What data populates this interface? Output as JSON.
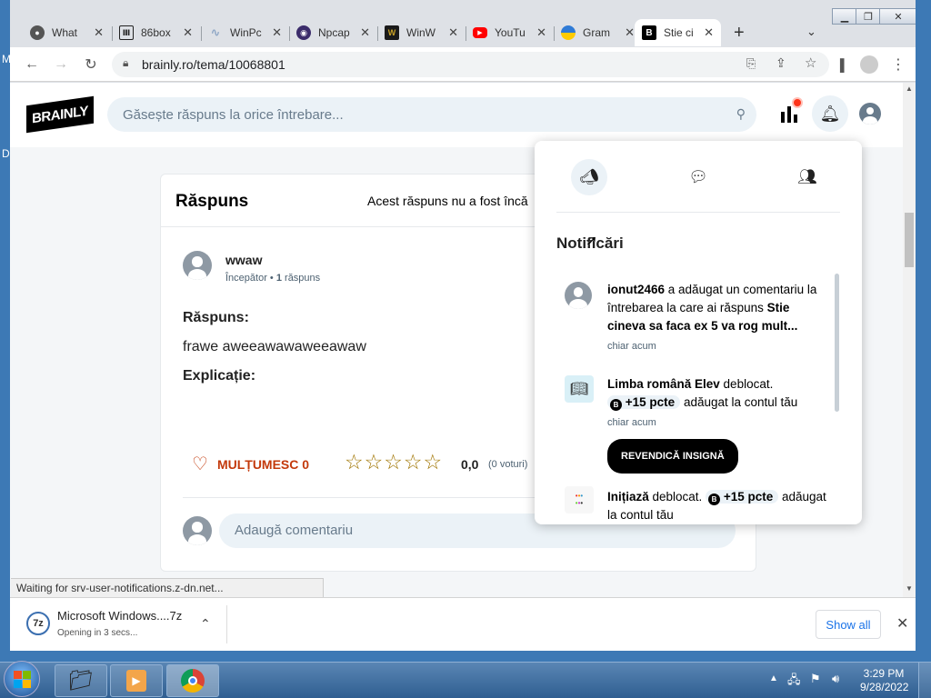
{
  "desktop": {
    "letter_top": "M",
    "letter_mid": "D"
  },
  "browser": {
    "tabs": [
      {
        "label": "What",
        "icon": "chrome-icon",
        "color": "#4285f4"
      },
      {
        "label": "86box",
        "icon": "library-icon",
        "color": "#222222"
      },
      {
        "label": "WinPc",
        "icon": "wave-icon",
        "color": "#8fa7c6"
      },
      {
        "label": "Npcap",
        "icon": "eye-icon",
        "color": "#3b2c6b"
      },
      {
        "label": "WinW",
        "icon": "w-logo-icon",
        "color": "#c9a227"
      },
      {
        "label": "YouTu",
        "icon": "youtube-icon",
        "color": "#ff0000"
      },
      {
        "label": "Gram",
        "icon": "globe-icon",
        "color": "#ffb300"
      },
      {
        "label": "Stie ci",
        "icon": "brainly-icon",
        "color": "#000000",
        "active": true
      }
    ],
    "url": "brainly.ro/tema/10068801",
    "status_text": "Waiting for srv-user-notifications.z-dn.net...",
    "download": {
      "filename": "Microsoft Windows....7z",
      "status": "Opening in 3 secs...",
      "show_all": "Show all"
    }
  },
  "brainly": {
    "logo": "BRAINLY",
    "search_placeholder": "Găsește răspuns la orice întrebare...",
    "answer": {
      "heading": "Răspuns",
      "note": "Acest răspuns nu a fost încă",
      "author": "wwaw",
      "rank": "Începător",
      "answers_count": "1",
      "answers_word": "răspuns",
      "label_answer": "Răspuns:",
      "text": "frawe aweeawawaweeawaw",
      "label_explanation": "Explicație:",
      "thanks": "MULȚUMESC",
      "thanks_count": "0",
      "rating_value": "0,0",
      "votes": "(0 voturi)",
      "stars": 0,
      "comment_placeholder": "Adaugă comentariu"
    },
    "notifications": {
      "title": "Notificări",
      "items": [
        {
          "user": "ionut2466",
          "text": " a adăugat un comentariu la întrebarea la care ai răspuns ",
          "question": "Stie cineva sa faca ex 5 va rog mult...",
          "time": "chiar acum"
        },
        {
          "bold1": "Limba română Elev",
          "text1": " deblocat. ",
          "points": "+15 pcte",
          "text2": " adăugat la contul tău",
          "time": "chiar acum",
          "button": "REVENDICĂ INSIGNĂ"
        },
        {
          "bold1": "Inițiază",
          "text1": " deblocat. ",
          "points": "+15 pcte",
          "text2": " adăugat la contul tău"
        }
      ]
    }
  },
  "taskbar": {
    "time": "3:29 PM",
    "date": "9/28/2022"
  }
}
